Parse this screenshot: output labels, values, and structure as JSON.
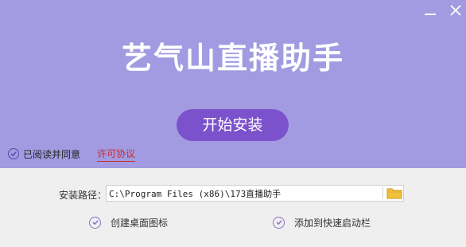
{
  "app": {
    "title": "艺气山直播助手"
  },
  "install": {
    "button_label": "开始安装"
  },
  "agreement": {
    "checked": true,
    "label": "已阅读并同意",
    "link_label": "许可协议"
  },
  "path": {
    "label": "安装路径：",
    "value": "C:\\Program Files (x86)\\173直播助手"
  },
  "options": [
    {
      "label": "创建桌面图标",
      "checked": true
    },
    {
      "label": "添加到快速启动栏",
      "checked": true
    }
  ],
  "icons": {
    "minimize": "minimize-icon",
    "close": "close-icon",
    "folder": "folder-icon",
    "check": "check-circle-icon"
  },
  "colors": {
    "header_bg": "#a29be1",
    "button_bg": "#7c52cc",
    "link": "#cc2b2b",
    "footer_bg": "#efefef"
  }
}
